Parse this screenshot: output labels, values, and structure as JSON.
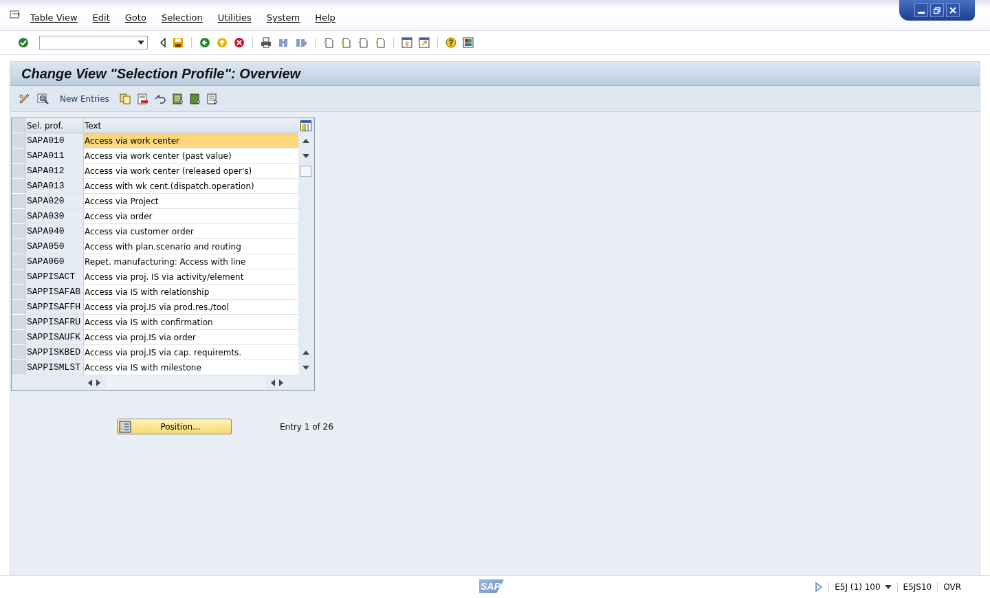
{
  "menu": [
    {
      "label": "Table View"
    },
    {
      "label": "Edit"
    },
    {
      "label": "Goto"
    },
    {
      "label": "Selection"
    },
    {
      "label": "Utilities"
    },
    {
      "label": "System"
    },
    {
      "label": "Help"
    }
  ],
  "title": "Change View \"Selection Profile\": Overview",
  "app_toolbar": {
    "new_entries": "New Entries"
  },
  "table": {
    "columns": [
      "Sel. prof.",
      "Text"
    ],
    "rows": [
      {
        "profile": "SAPA010",
        "text": "Access via work center",
        "selected": true
      },
      {
        "profile": "SAPA011",
        "text": "Access via work center (past value)",
        "selected": false
      },
      {
        "profile": "SAPA012",
        "text": "Access via work center (released oper's)",
        "selected": false
      },
      {
        "profile": "SAPA013",
        "text": "Access with wk cent.(dispatch.operation)",
        "selected": false
      },
      {
        "profile": "SAPA020",
        "text": "Access via Project",
        "selected": false
      },
      {
        "profile": "SAPA030",
        "text": "Access via order",
        "selected": false
      },
      {
        "profile": "SAPA040",
        "text": "Access via customer order",
        "selected": false
      },
      {
        "profile": "SAPA050",
        "text": "Access with plan.scenario and routing",
        "selected": false
      },
      {
        "profile": "SAPA060",
        "text": "Repet. manufacturing: Access with line",
        "selected": false
      },
      {
        "profile": "SAPPISACT",
        "text": "Access via proj. IS via activity/element",
        "selected": false
      },
      {
        "profile": "SAPPISAFAB",
        "text": "Access via IS with relationship",
        "selected": false
      },
      {
        "profile": "SAPPISAFFH",
        "text": "Access via proj.IS via prod.res./tool",
        "selected": false
      },
      {
        "profile": "SAPPISAFRU",
        "text": "Access via IS with confirmation",
        "selected": false
      },
      {
        "profile": "SAPPISAUFK",
        "text": "Access via proj.IS via order",
        "selected": false
      },
      {
        "profile": "SAPPISKBED",
        "text": "Access via proj.IS via cap. requiremts.",
        "selected": false
      },
      {
        "profile": "SAPPISMLST",
        "text": "Access via IS with milestone",
        "selected": false
      }
    ]
  },
  "position_button": "Position...",
  "entry_info": "Entry 1 of 26",
  "status_bar": {
    "logo": "SAP",
    "system": "E5J (1) 100",
    "server": "E5JS10",
    "mode": "OVR"
  }
}
